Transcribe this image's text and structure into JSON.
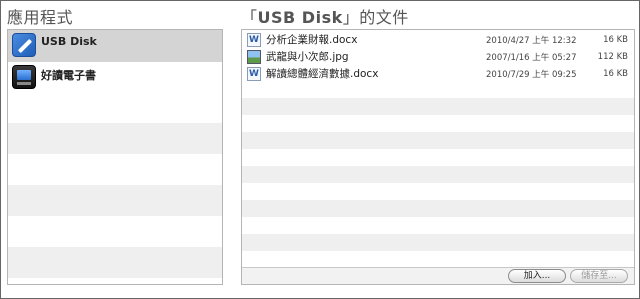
{
  "apps_heading": "應用程式",
  "files_heading": {
    "prefix": "「",
    "device": "USB Disk",
    "suffix": "」的文件"
  },
  "apps": [
    {
      "label": "USB Disk",
      "icon": "usb-disk-icon",
      "selected": true
    },
    {
      "label": "好讀電子書",
      "icon": "ebook-reader-icon",
      "selected": false
    }
  ],
  "files": [
    {
      "name": "分析企業財報.docx",
      "icon": "docx-file-icon",
      "date": "2010/4/27 上午 12:32",
      "size": "16 KB"
    },
    {
      "name": "武龍與小次郎.jpg",
      "icon": "jpg-file-icon",
      "date": "2007/1/16 上午 05:27",
      "size": "112 KB"
    },
    {
      "name": "解讀總體經濟數據.docx",
      "icon": "docx-file-icon",
      "date": "2010/7/29 上午 09:25",
      "size": "16 KB"
    }
  ],
  "buttons": {
    "add": "加入...",
    "save": "儲存至..."
  }
}
